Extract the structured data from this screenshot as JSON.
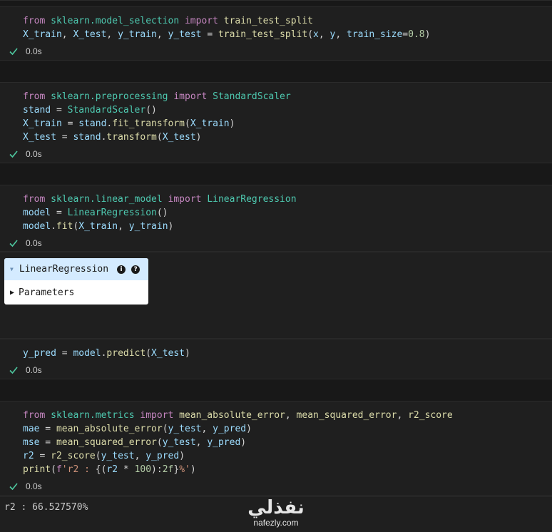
{
  "cells": [
    {
      "lines": [
        [
          [
            "kw",
            "from"
          ],
          [
            "op",
            " "
          ],
          [
            "mod",
            "sklearn.model_selection"
          ],
          [
            "op",
            " "
          ],
          [
            "kw",
            "import"
          ],
          [
            "op",
            " "
          ],
          [
            "fn",
            "train_test_split"
          ]
        ],
        [
          [
            "var",
            "X_train"
          ],
          [
            "op",
            ", "
          ],
          [
            "var",
            "X_test"
          ],
          [
            "op",
            ", "
          ],
          [
            "var",
            "y_train"
          ],
          [
            "op",
            ", "
          ],
          [
            "var",
            "y_test"
          ],
          [
            "op",
            " = "
          ],
          [
            "fn",
            "train_test_split"
          ],
          [
            "op",
            "("
          ],
          [
            "var",
            "x"
          ],
          [
            "op",
            ", "
          ],
          [
            "var",
            "y"
          ],
          [
            "op",
            ", "
          ],
          [
            "var",
            "train_size"
          ],
          [
            "op",
            "="
          ],
          [
            "num",
            "0.8"
          ],
          [
            "op",
            ")"
          ]
        ]
      ],
      "exec_time": "0.0s"
    },
    {
      "lines": [
        [
          [
            "kw",
            "from"
          ],
          [
            "op",
            " "
          ],
          [
            "mod",
            "sklearn.preprocessing"
          ],
          [
            "op",
            " "
          ],
          [
            "kw",
            "import"
          ],
          [
            "op",
            " "
          ],
          [
            "cls",
            "StandardScaler"
          ]
        ],
        [
          [
            "var",
            "stand"
          ],
          [
            "op",
            " = "
          ],
          [
            "cls",
            "StandardScaler"
          ],
          [
            "op",
            "()"
          ]
        ],
        [
          [
            "var",
            "X_train"
          ],
          [
            "op",
            " = "
          ],
          [
            "var",
            "stand"
          ],
          [
            "op",
            "."
          ],
          [
            "fn",
            "fit_transform"
          ],
          [
            "op",
            "("
          ],
          [
            "var",
            "X_train"
          ],
          [
            "op",
            ")"
          ]
        ],
        [
          [
            "var",
            "X_test"
          ],
          [
            "op",
            " = "
          ],
          [
            "var",
            "stand"
          ],
          [
            "op",
            "."
          ],
          [
            "fn",
            "transform"
          ],
          [
            "op",
            "("
          ],
          [
            "var",
            "X_test"
          ],
          [
            "op",
            ")"
          ]
        ]
      ],
      "exec_time": "0.0s"
    },
    {
      "lines": [
        [
          [
            "kw",
            "from"
          ],
          [
            "op",
            " "
          ],
          [
            "mod",
            "sklearn.linear_model"
          ],
          [
            "op",
            " "
          ],
          [
            "kw",
            "import"
          ],
          [
            "op",
            " "
          ],
          [
            "cls",
            "LinearRegression"
          ]
        ],
        [
          [
            "var",
            "model"
          ],
          [
            "op",
            " = "
          ],
          [
            "cls",
            "LinearRegression"
          ],
          [
            "op",
            "()"
          ]
        ],
        [
          [
            "var",
            "model"
          ],
          [
            "op",
            "."
          ],
          [
            "fn",
            "fit"
          ],
          [
            "op",
            "("
          ],
          [
            "var",
            "X_train"
          ],
          [
            "op",
            ", "
          ],
          [
            "var",
            "y_train"
          ],
          [
            "op",
            ")"
          ]
        ]
      ],
      "exec_time": "0.0s"
    },
    {
      "lines": [
        [
          [
            "var",
            "y_pred"
          ],
          [
            "op",
            " = "
          ],
          [
            "var",
            "model"
          ],
          [
            "op",
            "."
          ],
          [
            "fn",
            "predict"
          ],
          [
            "op",
            "("
          ],
          [
            "var",
            "X_test"
          ],
          [
            "op",
            ")"
          ]
        ]
      ],
      "exec_time": "0.0s"
    },
    {
      "lines": [
        [
          [
            "kw",
            "from"
          ],
          [
            "op",
            " "
          ],
          [
            "mod",
            "sklearn.metrics"
          ],
          [
            "op",
            " "
          ],
          [
            "kw",
            "import"
          ],
          [
            "op",
            " "
          ],
          [
            "fn",
            "mean_absolute_error"
          ],
          [
            "op",
            ", "
          ],
          [
            "fn",
            "mean_squared_error"
          ],
          [
            "op",
            ", "
          ],
          [
            "fn",
            "r2_score"
          ]
        ],
        [
          [
            "var",
            "mae"
          ],
          [
            "op",
            " = "
          ],
          [
            "fn",
            "mean_absolute_error"
          ],
          [
            "op",
            "("
          ],
          [
            "var",
            "y_test"
          ],
          [
            "op",
            ", "
          ],
          [
            "var",
            "y_pred"
          ],
          [
            "op",
            ")"
          ]
        ],
        [
          [
            "var",
            "mse"
          ],
          [
            "op",
            " = "
          ],
          [
            "fn",
            "mean_squared_error"
          ],
          [
            "op",
            "("
          ],
          [
            "var",
            "y_test"
          ],
          [
            "op",
            ", "
          ],
          [
            "var",
            "y_pred"
          ],
          [
            "op",
            ")"
          ]
        ],
        [
          [
            "var",
            "r2"
          ],
          [
            "op",
            " = "
          ],
          [
            "fn",
            "r2_score"
          ],
          [
            "op",
            "("
          ],
          [
            "var",
            "y_test"
          ],
          [
            "op",
            ", "
          ],
          [
            "var",
            "y_pred"
          ],
          [
            "op",
            ")"
          ]
        ],
        [
          [
            "fn",
            "print"
          ],
          [
            "op",
            "("
          ],
          [
            "kw",
            "f"
          ],
          [
            "str",
            "'r2 : "
          ],
          [
            "op",
            "{("
          ],
          [
            "var",
            "r2"
          ],
          [
            "op",
            " * "
          ],
          [
            "num",
            "100"
          ],
          [
            "op",
            "):"
          ],
          [
            "num",
            "2f"
          ],
          [
            "op",
            "}"
          ],
          [
            "str",
            "%'"
          ],
          [
            "op",
            ")"
          ]
        ]
      ],
      "exec_time": "0.0s"
    }
  ],
  "estimator_widget": {
    "title": "LinearRegression",
    "parameters_label": "Parameters"
  },
  "output_text": "r2 : 66.527570%",
  "watermark": {
    "arabic": "نفذلي",
    "url": "nafezly.com"
  },
  "colors": {
    "background": "#1f1f1f",
    "keyword": "#c586c0",
    "module": "#4ec9b0",
    "function": "#dcdcaa",
    "variable": "#9cdcfe",
    "number": "#b5cea8",
    "check": "#4ec9a0",
    "widget_header": "#d4ebff"
  },
  "icons": [
    "check-icon",
    "info-icon",
    "help-icon",
    "expand-triangle-icon",
    "collapse-triangle-icon"
  ]
}
